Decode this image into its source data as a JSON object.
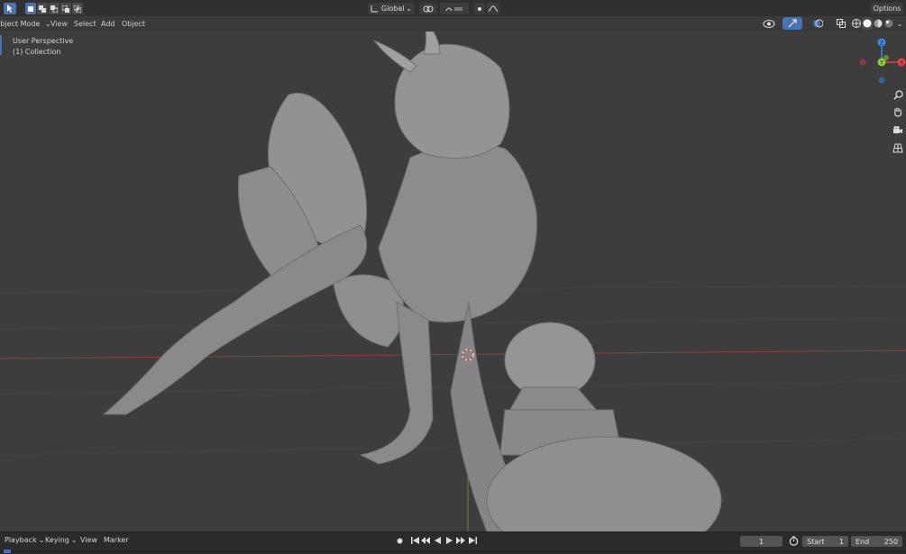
{
  "header": {
    "transform_orientation": "Global",
    "options_label": "Options"
  },
  "mode_bar": {
    "mode_label": "Object Mode",
    "menus": [
      "View",
      "Select",
      "Add",
      "Object"
    ]
  },
  "viewport": {
    "view_name": "User Perspective",
    "collection": "(1) Collection",
    "gizmo_axes": [
      "X",
      "Y",
      "Z"
    ]
  },
  "timeline": {
    "menus": [
      "Playback",
      "Keying",
      "View",
      "Marker"
    ],
    "current_frame": "1",
    "start_label": "Start",
    "start_value": "1",
    "end_label": "End",
    "end_value": "250"
  },
  "colors": {
    "accent": "#4772b3",
    "x_axis": "#e6404c",
    "y_axis": "#8fcc3a",
    "z_axis": "#3f86ea",
    "grid_red": "#9a3b3b",
    "grid_green": "#5a8a2f"
  }
}
